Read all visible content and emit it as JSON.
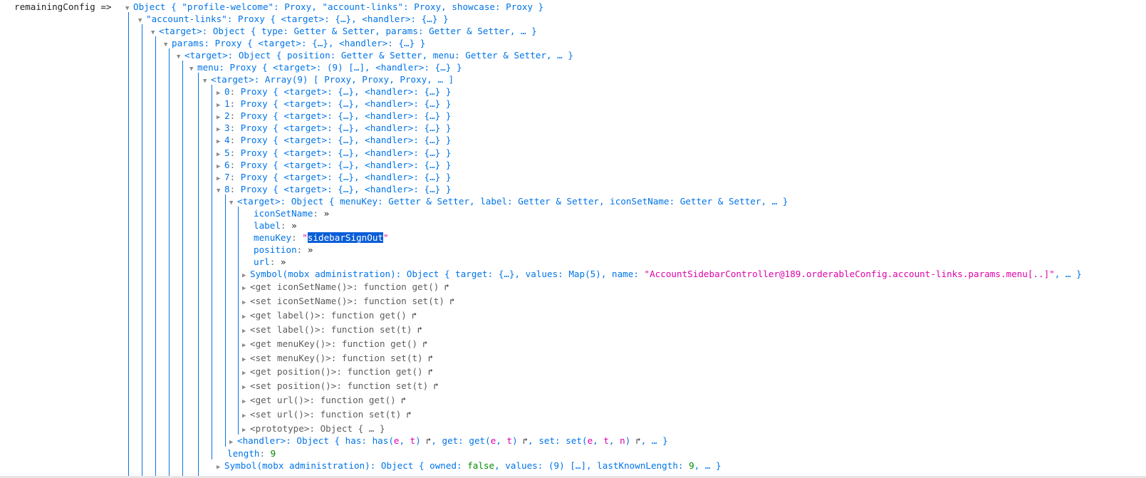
{
  "console": {
    "label": "remainingConfig =>",
    "rows": [
      {
        "text": "Object { \"profile-welcome\": Proxy, \"account-links\": Proxy, showcase: Proxy }",
        "twisty": "open"
      },
      {
        "text": "\"account-links\": Proxy { <target>: {…}, <handler>: {…} }",
        "twisty": "open"
      },
      {
        "text": "<target>: Object { type: Getter & Setter, params: Getter & Setter, … }",
        "twisty": "open"
      },
      {
        "text": "params: Proxy { <target>: {…}, <handler>: {…} }",
        "twisty": "open"
      },
      {
        "text": "<target>: Object { position: Getter & Setter, menu: Getter & Setter, … }",
        "twisty": "open"
      },
      {
        "text": "menu: Proxy { <target>: (9) […], <handler>: {…} }",
        "twisty": "open"
      },
      {
        "text": "<target>: Array(9) [ Proxy, Proxy, Proxy, … ]",
        "twisty": "open"
      }
    ],
    "menu_items": [
      {
        "index": "0",
        "text": "Proxy { <target>: {…}, <handler>: {…} }"
      },
      {
        "index": "1",
        "text": "Proxy { <target>: {…}, <handler>: {…} }"
      },
      {
        "index": "2",
        "text": "Proxy { <target>: {…}, <handler>: {…} }"
      },
      {
        "index": "3",
        "text": "Proxy { <target>: {…}, <handler>: {…} }"
      },
      {
        "index": "4",
        "text": "Proxy { <target>: {…}, <handler>: {…} }"
      },
      {
        "index": "5",
        "text": "Proxy { <target>: {…}, <handler>: {…} }"
      },
      {
        "index": "6",
        "text": "Proxy { <target>: {…}, <handler>: {…} }"
      },
      {
        "index": "7",
        "text": "Proxy { <target>: {…}, <handler>: {…} }"
      },
      {
        "index": "8",
        "text": "Proxy { <target>: {…}, <handler>: {…} }"
      }
    ],
    "item8_target": "<target>: Object { menuKey: Getter & Setter, label: Getter & Setter, iconSetName: Getter & Setter, … }",
    "props": [
      {
        "key": "iconSetName",
        "value": "»"
      },
      {
        "key": "label",
        "value": "»"
      },
      {
        "key": "menuKey",
        "value": "sidebarSignOut",
        "quoted": true
      },
      {
        "key": "position",
        "value": "»"
      },
      {
        "key": "url",
        "value": "»"
      }
    ],
    "symbol_row": {
      "prefix": "Symbol(mobx administration): Object { target: {…}, values: Map(5), name: ",
      "name_value": "\"AccountSidebarController@189.orderableConfig.account-links.params.menu[..]\"",
      "suffix": ", … }"
    },
    "accessors": [
      {
        "label": "<get iconSetName()>:",
        "fn": "function get()"
      },
      {
        "label": "<set iconSetName()>:",
        "fn": "function set(t)"
      },
      {
        "label": "<get label()>:",
        "fn": "function get()"
      },
      {
        "label": "<set label()>:",
        "fn": "function set(t)"
      },
      {
        "label": "<get menuKey()>:",
        "fn": "function get()"
      },
      {
        "label": "<set menuKey()>:",
        "fn": "function set(t)"
      },
      {
        "label": "<get position()>:",
        "fn": "function get()"
      },
      {
        "label": "<set position()>:",
        "fn": "function set(t)"
      },
      {
        "label": "<get url()>:",
        "fn": "function get()"
      },
      {
        "label": "<set url()>:",
        "fn": "function set(t)"
      }
    ],
    "prototype_row": "<prototype>: Object { … }",
    "handler_row": {
      "prefix": "<handler>: Object { ",
      "entries": [
        {
          "key": "has",
          "fn": "has",
          "args": [
            "e",
            "t"
          ]
        },
        {
          "key": "get",
          "fn": "get",
          "args": [
            "e",
            "t"
          ]
        },
        {
          "key": "set",
          "fn": "set",
          "args": [
            "e",
            "t",
            "n"
          ]
        }
      ],
      "suffix": "… }"
    },
    "length_row": {
      "key": "length",
      "value": "9"
    },
    "bottom_row": {
      "prefix": "Symbol(mobx administration): Object { owned: ",
      "owned": "false",
      "middle": ", values: (9) […], lastKnownLength: ",
      "lastKnownLength": "9",
      "suffix": ", … }"
    },
    "jump_icon": "jump-to-definition-icon",
    "highlight_color": "#0a5ed8",
    "key_color": "#0074e8",
    "string_color": "#dd00a9",
    "number_color": "#058b00"
  }
}
